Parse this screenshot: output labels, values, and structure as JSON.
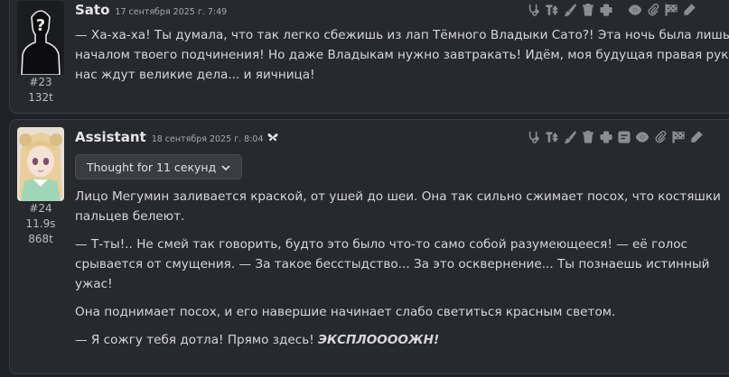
{
  "messages": [
    {
      "author": "Sato",
      "date": "17 сентября 2025 г. 7:49",
      "number": "#23",
      "tokens": "132t",
      "avatar_icon": "silhouette-avatar",
      "text": "— Ха-ха-ха! Ты думала, что так легко сбежишь из лап Тёмного Владыки Сато?! Эта ночь была лишь началом твоего подчинения! Но даже Владыкам нужно завтракать! Идём, моя будущая правая рука, нас ждут великие дела... и яичница!"
    },
    {
      "author": "Assistant",
      "date": "18 сентября 2025 г. 8:04",
      "flag_icon": "butterfly-icon",
      "number": "#24",
      "time": "11.9s",
      "tokens": "868t",
      "avatar_icon": "anime-girl-avatar",
      "thought_label": "Thought for 11 секунд",
      "paragraphs": [
        "Лицо Мегумин заливается краской, от ушей до шеи. Она так сильно сжимает посох, что костяшки пальцев белеют.",
        "— Т-ты!.. Не смей так говорить, будто это было что-то само собой разумеющееся! — её голос срывается от смущения. — За такое бесстыдство... За это осквернение... Ты познаешь истинный ужас!",
        "Она поднимает посох, и его навершие начинает слабо светиться красным светом."
      ],
      "last_line_plain": "— Я сожгу тебя дотла! Прямо здесь! ",
      "last_line_emphasis": "ЭКСПЛООООЖН!"
    }
  ],
  "toolbar_icons": [
    "stethoscope-icon",
    "swap-height-icon",
    "brush-icon",
    "trash-icon",
    "plus-icon",
    "eye-icon",
    "paperclip-icon",
    "flag-icon",
    "pencil-icon"
  ],
  "colors": {
    "background": "#1f2126",
    "message_bg": "#27292f",
    "border": "#3a3d44",
    "icon": "#8a8d93"
  }
}
